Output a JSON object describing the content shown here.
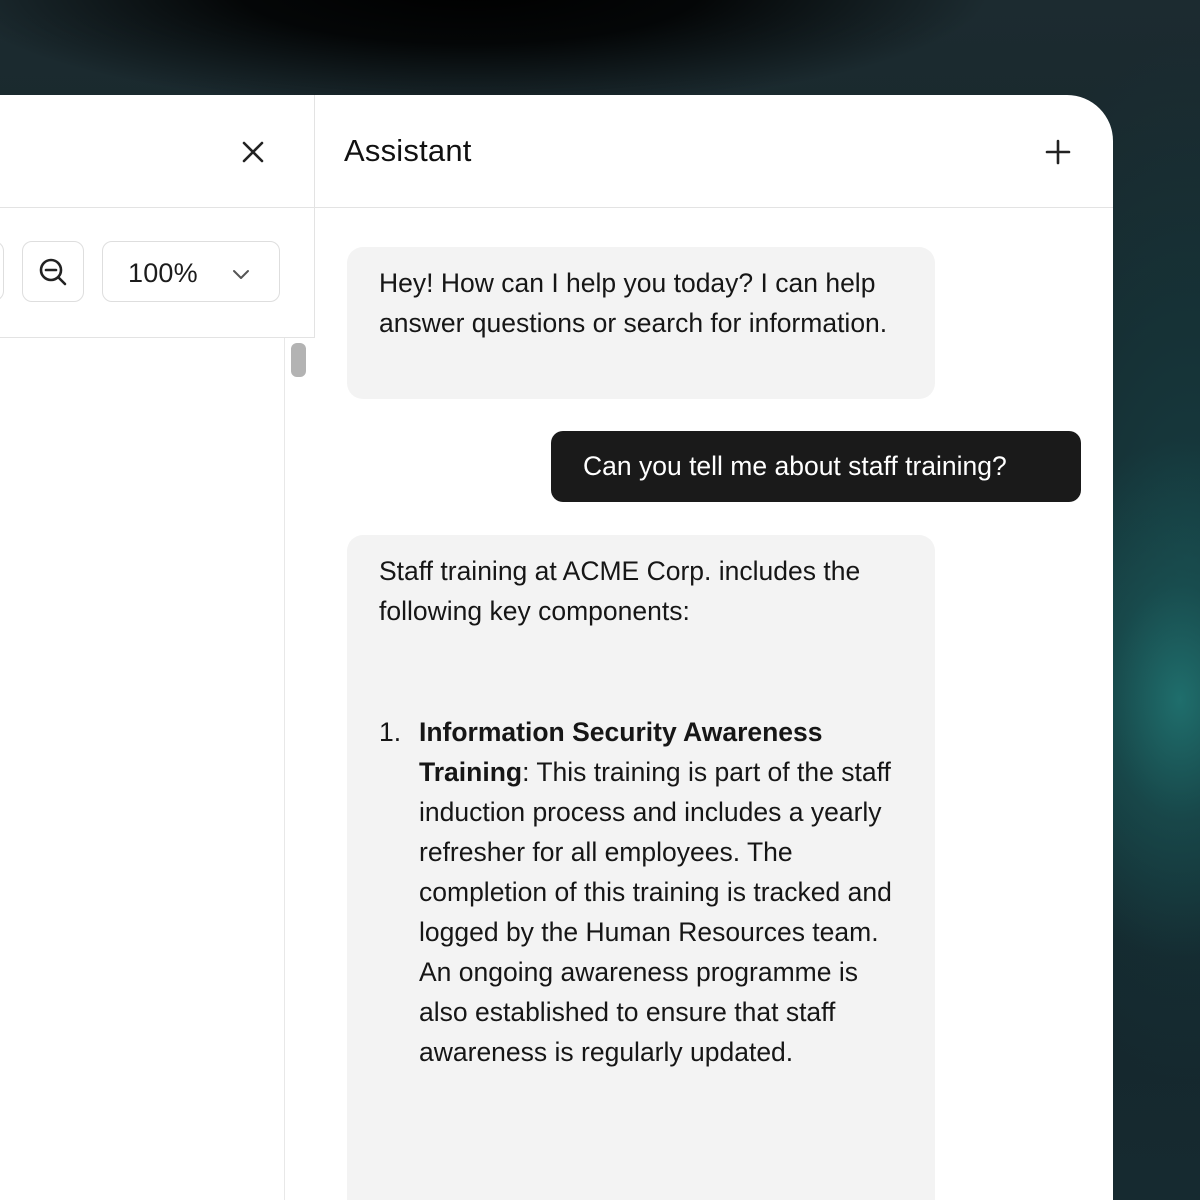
{
  "viewer": {
    "zoom_level": "100%"
  },
  "assistant": {
    "title": "Assistant",
    "messages": [
      {
        "role": "assistant",
        "text": "Hey! How can I help you today? I can help answer questions or search for information."
      },
      {
        "role": "user",
        "text": "Can you tell me about staff training?"
      },
      {
        "role": "assistant",
        "intro": "Staff training at ACME Corp. includes the following key components:",
        "items": [
          {
            "number": "1.",
            "title": "Information Security Awareness Training",
            "body": ": This training is part of the staff induction process and includes a yearly refresher for all employees. The completion of this training is tracked and logged by the Human Resources team. An ongoing awareness programme is also established to ensure that staff awareness is regularly updated."
          }
        ]
      }
    ]
  },
  "icons": {
    "close": "close-icon",
    "zoom_out": "zoom-out-icon",
    "dropdown": "chevron-down-icon",
    "new_chat": "plus-icon"
  },
  "colors": {
    "user_bubble": "#1a1a1a",
    "assistant_bubble": "#f3f3f3",
    "border": "#e3e3e3"
  }
}
